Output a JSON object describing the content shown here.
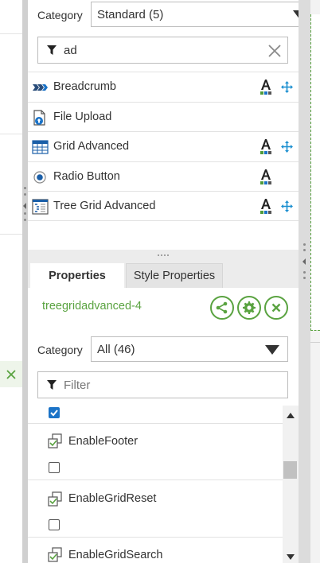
{
  "components_panel": {
    "category_label": "Category",
    "category_value": "Standard (5)",
    "search_value": "ad",
    "items": [
      {
        "label": "Breadcrumb",
        "icon": "breadcrumb-icon",
        "has_style": true,
        "has_move": true
      },
      {
        "label": "File Upload",
        "icon": "file-upload-icon",
        "has_style": false,
        "has_move": false
      },
      {
        "label": "Grid Advanced",
        "icon": "grid-icon",
        "has_style": true,
        "has_move": true
      },
      {
        "label": "Radio Button",
        "icon": "radio-icon",
        "has_style": true,
        "has_move": false
      },
      {
        "label": "Tree Grid Advanced",
        "icon": "tree-grid-icon",
        "has_style": true,
        "has_move": true
      }
    ]
  },
  "properties_panel": {
    "tabs": [
      {
        "label": "Properties",
        "active": true
      },
      {
        "label": "Style Properties",
        "active": false
      }
    ],
    "object_name": "treegridadvanced-4",
    "actions": [
      "share-icon",
      "gear-icon",
      "close-icon"
    ],
    "category_label": "Category",
    "category_value": "All (46)",
    "filter_placeholder": "Filter",
    "properties": [
      {
        "name": "",
        "checked": true
      },
      {
        "name": "EnableFooter",
        "checked": false
      },
      {
        "name": "EnableGridReset",
        "checked": false
      },
      {
        "name": "EnableGridSearch",
        "checked": false
      }
    ]
  },
  "colors": {
    "accent_green": "#5aa341",
    "checkbox_blue": "#1b73c7",
    "icon_blue": "#1b73c7"
  }
}
